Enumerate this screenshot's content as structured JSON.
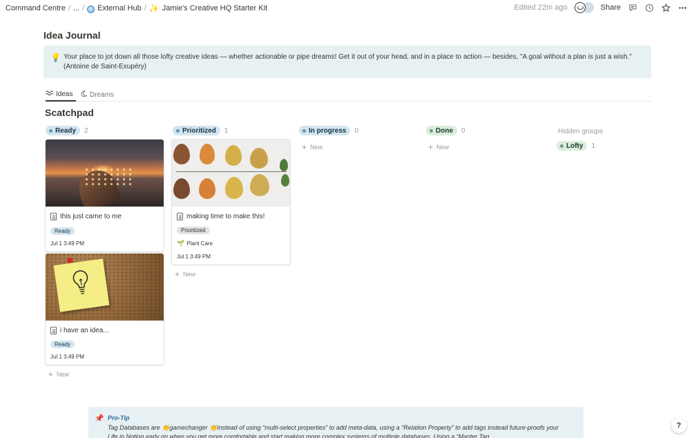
{
  "breadcrumb": {
    "items": [
      "Command Centre",
      "...",
      "External Hub",
      "Jamie's Creative HQ Starter Kit"
    ],
    "separator": "/"
  },
  "topbar": {
    "edited": "Edited 22m ago",
    "share": "Share"
  },
  "page": {
    "title": "Idea Journal",
    "callout": "Your place to jot down all those lofty creative ideas — whether actionable or pipe dreams! Get it out of your head, and in a place to action — besides, \"A goal without a plan is just a wish.\" (Antoine de Saint-Exupéry)"
  },
  "tabs": [
    {
      "label": "Ideas",
      "icon": "waves-icon"
    },
    {
      "label": "Dreams",
      "icon": "moon-icon"
    }
  ],
  "board": {
    "title": "Scatchpad",
    "columns": [
      {
        "label": "Ready",
        "count": "2",
        "color": "#5b97bd"
      },
      {
        "label": "Prioritized",
        "count": "1",
        "color": "#5b97bd"
      },
      {
        "label": "In progress",
        "count": "0",
        "color": "#5b97bd"
      },
      {
        "label": "Done",
        "count": "0",
        "color": "#6c9b7d"
      }
    ],
    "hidden_groups_label": "Hidden groups",
    "hidden_group": {
      "label": "Lofty",
      "count": "1"
    },
    "new_label": "New",
    "cards": [
      {
        "title": "this just came to me",
        "tag": "Ready",
        "date": "Jul 1 3:49 PM"
      },
      {
        "title": "i have an idea...",
        "tag": "Ready",
        "date": "Jul 1 3:49 PM"
      },
      {
        "title": "making time to make this!",
        "tag": "Prioritized",
        "relation": "Plant Care",
        "date": "Jul 1 3:49 PM"
      }
    ]
  },
  "protip": {
    "title": "Pro-Tip",
    "body": "Tag Databases are 👏gamechanger 👏Instead of using “multi-select properties” to add meta-data, using a “Relation Property” to add tags instead future-proofs your Life in Notion early on when you get more comfortable and start making more complex systems of multiple databases. Using a “Master Tag"
  },
  "help": "?"
}
